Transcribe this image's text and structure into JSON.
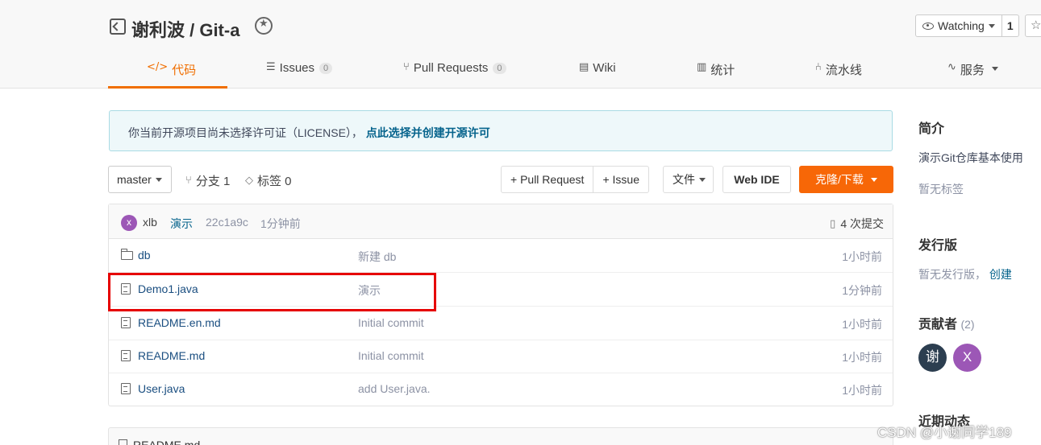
{
  "header": {
    "repo_title": "谢利波 / Git-a",
    "watch_label": "Watching",
    "watch_count": "1"
  },
  "tabs": [
    {
      "label": "代码",
      "icon": "code-icon",
      "active": true
    },
    {
      "label": "Issues",
      "count": "0",
      "icon": "issues-icon"
    },
    {
      "label": "Pull Requests",
      "count": "0",
      "icon": "pull-request-icon"
    },
    {
      "label": "Wiki",
      "icon": "wiki-icon"
    },
    {
      "label": "统计",
      "icon": "stats-icon"
    },
    {
      "label": "流水线",
      "icon": "pipeline-icon"
    },
    {
      "label": "服务",
      "icon": "service-icon"
    }
  ],
  "notice": {
    "text": "你当前开源项目尚未选择许可证（LICENSE），",
    "link": "点此选择并创建开源许可"
  },
  "toolbar": {
    "branch": "master",
    "branches_label": "分支 1",
    "tags_label": "标签 0",
    "pull_request": "+ Pull Request",
    "issue": "+ Issue",
    "file": "文件",
    "web_ide": "Web IDE",
    "clone": "克隆/下载"
  },
  "latest_commit": {
    "avatar_letter": "x",
    "author": "xlb",
    "message": "演示",
    "hash": "22c1a9c",
    "time": "1分钟前",
    "commit_count": "4 次提交"
  },
  "files": [
    {
      "name": "db",
      "type": "folder",
      "message": "新建 db",
      "time": "1小时前"
    },
    {
      "name": "Demo1.java",
      "type": "file",
      "message": "演示",
      "time": "1分钟前"
    },
    {
      "name": "README.en.md",
      "type": "file",
      "message": "Initial commit",
      "time": "1小时前"
    },
    {
      "name": "README.md",
      "type": "file",
      "message": "Initial commit",
      "time": "1小时前"
    },
    {
      "name": "User.java",
      "type": "file",
      "message": "add User.java.",
      "time": "1小时前"
    }
  ],
  "readme": {
    "label": "README.md"
  },
  "sidebar": {
    "intro_title": "简介",
    "intro_text": "演示Git仓库基本使用",
    "no_tags": "暂无标签",
    "release_title": "发行版",
    "no_release": "暂无发行版，",
    "create_link": "创建",
    "contributors_title": "贡献者",
    "contributors_count": "(2)",
    "contributors": [
      {
        "letter": "谢",
        "color": "#2c3e50"
      },
      {
        "letter": "X",
        "color": "#9c57b6"
      }
    ],
    "activity_title": "近期动态"
  },
  "watermark": "CSDN @小谢同学189",
  "colors": {
    "accent": "#f06e00",
    "clone_button": "#f76707",
    "link": "#05638c",
    "highlight": "#e60000"
  }
}
